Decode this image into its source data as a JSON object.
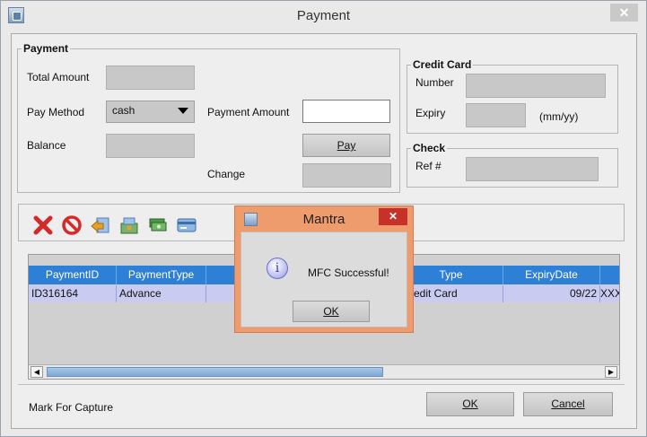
{
  "window": {
    "title": "Payment",
    "close_glyph": "✕"
  },
  "payment": {
    "legend": "Payment",
    "total_amount_label": "Total Amount",
    "pay_method_label": "Pay Method",
    "pay_method_value": "cash",
    "payment_amount_label": "Payment Amount",
    "balance_label": "Balance",
    "pay_button_label": "Pay",
    "change_label": "Change"
  },
  "credit_card": {
    "legend": "Credit Card",
    "number_label": "Number",
    "expiry_label": "Expiry",
    "expiry_hint": "(mm/yy)"
  },
  "check": {
    "legend": "Check",
    "ref_label": "Ref #"
  },
  "toolbar": {
    "icons": [
      "delete-icon",
      "cancel-icon",
      "back-icon",
      "capture-icon",
      "cash-icon",
      "card-icon"
    ]
  },
  "table": {
    "columns": [
      "PaymentID",
      "PaymentType",
      "",
      "Type",
      "ExpiryDate"
    ],
    "rows": [
      [
        "ID316164",
        "Advance",
        "",
        "redit Card",
        "09/22",
        "XXX"
      ]
    ]
  },
  "status_text": "Mark For Capture",
  "buttons": {
    "ok": "OK",
    "cancel": "Cancel"
  },
  "dialog": {
    "title": "Mantra",
    "message": "MFC Successful!",
    "ok": "OK",
    "info_glyph": "i",
    "close_glyph": "✕"
  },
  "colors": {
    "header_blue": "#2e7fd6",
    "row_selected": "#c9cbf0",
    "dialog_frame": "#ee9b6d",
    "dialog_close": "#c7312a"
  }
}
